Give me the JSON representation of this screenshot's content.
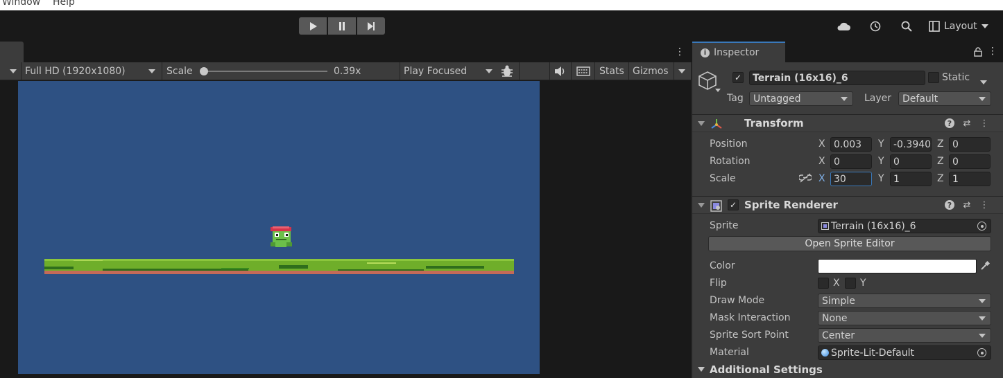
{
  "menubar": {
    "items": [
      "Window",
      "Help"
    ]
  },
  "toolbar": {
    "icons": [
      "play-icon",
      "pause-icon",
      "step-icon",
      "cloud-icon",
      "history-icon",
      "search-icon",
      "layout-icon"
    ],
    "layout_label": "Layout"
  },
  "game_toolbar": {
    "resolution": "Full HD (1920x1080)",
    "scale_label": "Scale",
    "scale_value": "0.39x",
    "scale_fraction": 0.01,
    "play_mode": "Play Focused",
    "stats_label": "Stats",
    "gizmos_label": "Gizmos"
  },
  "inspector": {
    "tab_label": "Inspector",
    "object_name": "Terrain (16x16)_6",
    "static_label": "Static",
    "tag_label": "Tag",
    "tag_value": "Untagged",
    "layer_label": "Layer",
    "layer_value": "Default",
    "transform": {
      "title": "Transform",
      "position_label": "Position",
      "rotation_label": "Rotation",
      "scale_label": "Scale",
      "axis_x": "X",
      "axis_y": "Y",
      "axis_z": "Z",
      "position": {
        "x": "0.003",
        "y": "-0.3940",
        "z": "0"
      },
      "rotation": {
        "x": "0",
        "y": "0",
        "z": "0"
      },
      "scale": {
        "x": "30",
        "y": "1",
        "z": "1"
      }
    },
    "sprite_renderer": {
      "title": "Sprite Renderer",
      "sprite_label": "Sprite",
      "sprite_value": "Terrain (16x16)_6",
      "open_editor_label": "Open Sprite Editor",
      "color_label": "Color",
      "color_value": "#ffffff",
      "flip_label": "Flip",
      "flip_x": "X",
      "flip_y": "Y",
      "draw_mode_label": "Draw Mode",
      "draw_mode_value": "Simple",
      "mask_label": "Mask Interaction",
      "mask_value": "None",
      "sort_point_label": "Sprite Sort Point",
      "sort_point_value": "Center",
      "material_label": "Material",
      "material_value": "Sprite-Lit-Default",
      "additional_settings_label": "Additional Settings"
    }
  },
  "colors": {
    "game_background": "#2e5183",
    "grass": "#6fae2a",
    "dirt": "#c46a58"
  }
}
